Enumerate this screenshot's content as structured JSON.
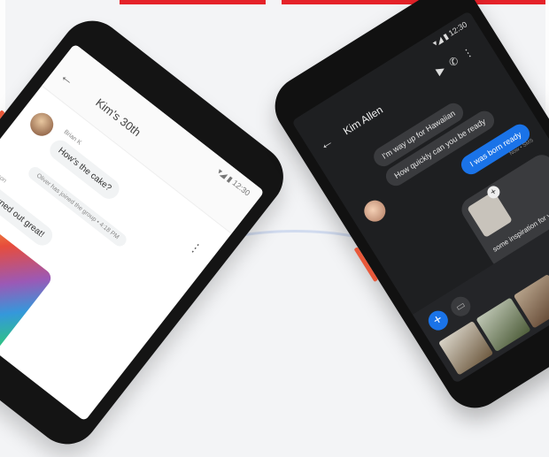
{
  "left_phone": {
    "title": "Kim's 30th",
    "status": "▾◢ ▮ 12:30",
    "sender": "Brian K",
    "message_1": "How's the cake?",
    "notice": "Oliver has joined the group • 4:18 PM",
    "label": "Jason",
    "message_2": "It turned out great!",
    "back_icon": "arrow-left-icon",
    "menu_icon": "more-vert-icon"
  },
  "right_phone": {
    "status": "▾◢ ▮ 12:30",
    "title": "Kim Allen",
    "message_1": "I'm way up for Hawaiian",
    "message_2": "How quickly can you be ready",
    "message_3": "I was born ready",
    "meta": "Now • SMS",
    "card_text": "some inspiration for you",
    "icons": [
      "video-icon",
      "phone-icon",
      "more-vert-icon"
    ],
    "fab": "+",
    "colors": {
      "accent": "#1a73e8",
      "dark_bg": "#1e1f21",
      "bubble": "#3a3b3e"
    }
  }
}
